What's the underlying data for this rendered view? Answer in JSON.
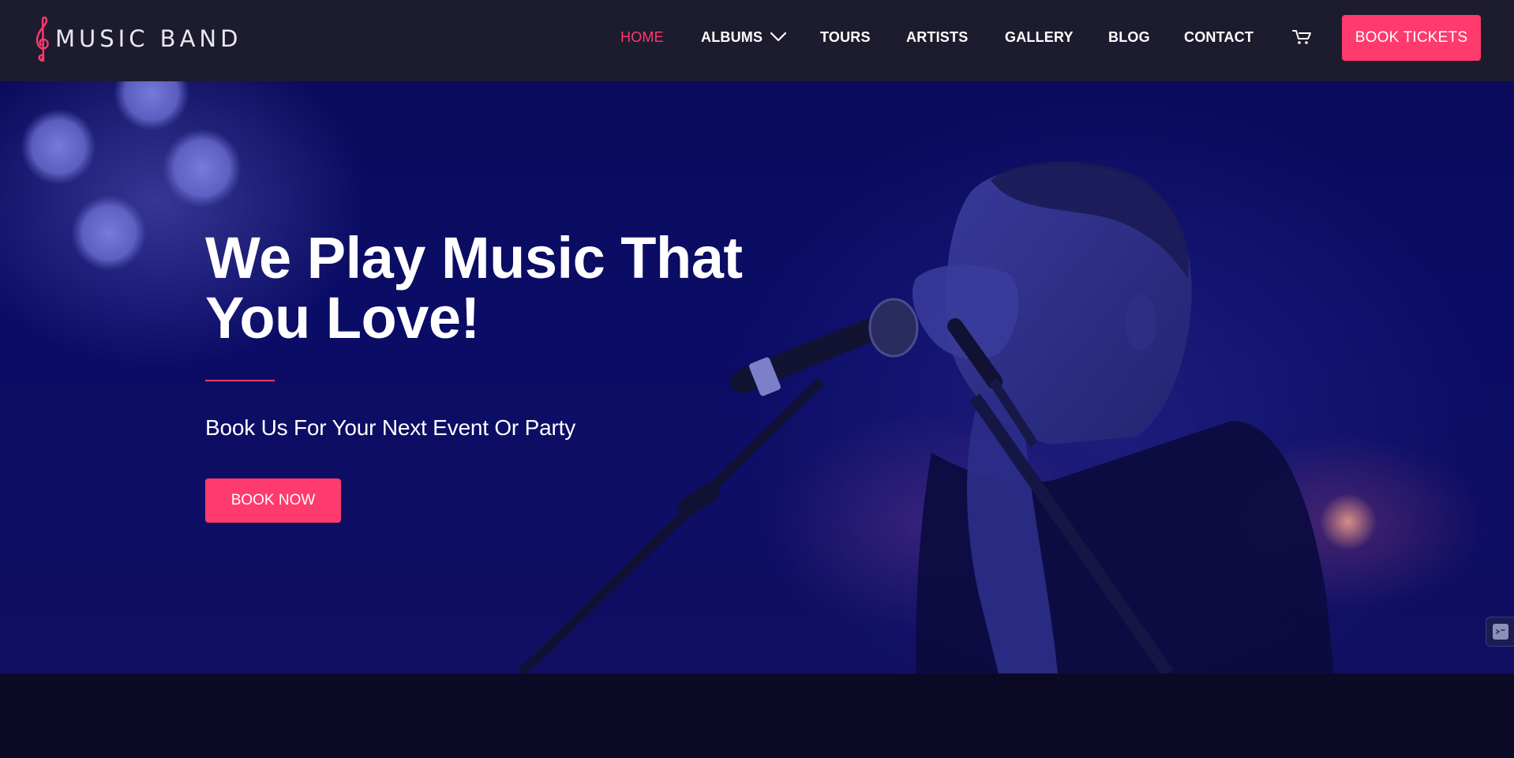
{
  "brand": {
    "logo_text": "MUSIC BAND",
    "logo_icon": "treble-clef-icon",
    "accent_color": "#ff3a6d"
  },
  "nav": {
    "items": [
      {
        "label": "HOME",
        "active": true
      },
      {
        "label": "ALBUMS",
        "has_dropdown": true
      },
      {
        "label": "TOURS"
      },
      {
        "label": "ARTISTS"
      },
      {
        "label": "GALLERY"
      },
      {
        "label": "BLOG"
      },
      {
        "label": "CONTACT"
      }
    ],
    "cart_icon": "cart-icon",
    "cta_label": "BOOK TICKETS"
  },
  "hero": {
    "title_line1": "We Play Music That",
    "title_line2": "You Love!",
    "subtitle": "Book Us For Your Next Event Or Party",
    "button_label": "BOOK NOW",
    "background_image": "singer-at-microphone-photo"
  },
  "widgets": {
    "side_icon": "code-widget-icon"
  },
  "colors": {
    "header_bg": "#1d1c2e",
    "hero_tint": "#0b0c66",
    "page_bg": "#0b0a26",
    "text": "#ffffff"
  }
}
